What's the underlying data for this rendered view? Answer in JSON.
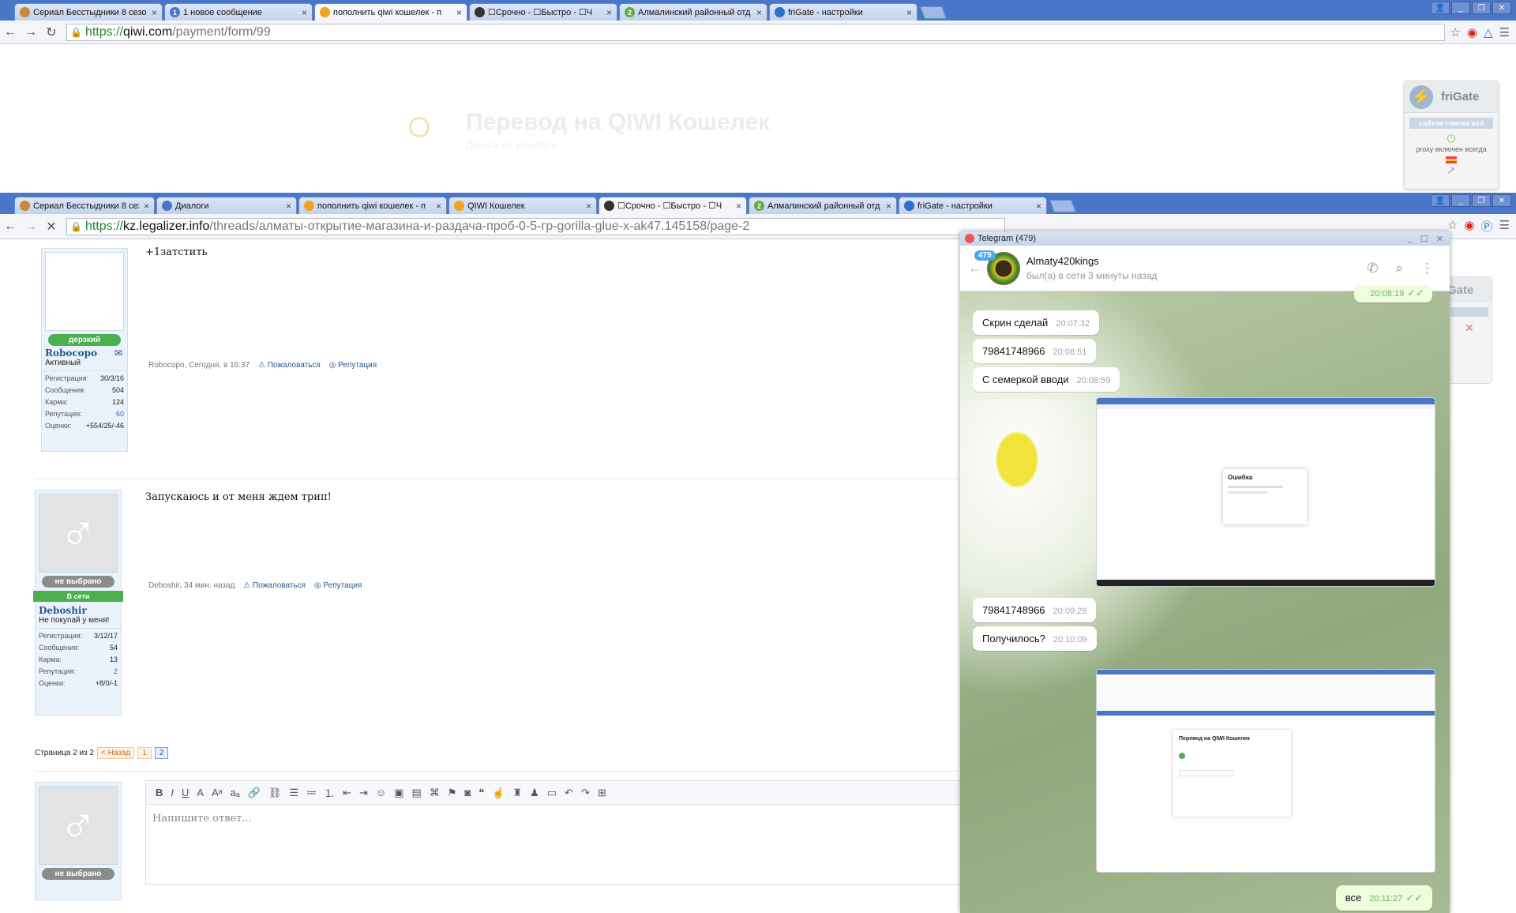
{
  "browser1": {
    "tabs": [
      {
        "title": "Сериал Бесстыдники 8 сезон",
        "fav": "#c98a3a"
      },
      {
        "title": "1 новое сообщение",
        "fav": "#4a76c9",
        "favtext": "1"
      },
      {
        "title": "пополнить qiwi кошелек - п",
        "fav": "#f3a41c",
        "active": true
      },
      {
        "title": "☐Срочно - ☐Быстро - ☐Ч",
        "fav": "#333"
      },
      {
        "title": "Алмалинский районный отд",
        "fav": "#5fae3a",
        "favtext": "2"
      },
      {
        "title": "friGate - настройки",
        "fav": "#2a6fd1"
      }
    ],
    "url_https": "https://",
    "url_host": "qiwi.com",
    "url_path": "/payment/form/99"
  },
  "qiwi": {
    "title": "Перевод на QIWI Кошелек",
    "subtitle": "Деньги на кошелек"
  },
  "frigate": {
    "title": "friGate",
    "badge": "сайтов списка asd",
    "status": "proxy включен всегда"
  },
  "browser2": {
    "tabs": [
      {
        "title": "Сериал Бесстыдники 8 сезон",
        "fav": "#c98a3a"
      },
      {
        "title": "Диалоги",
        "fav": "#4a76c9"
      },
      {
        "title": "пополнить qiwi кошелек - п",
        "fav": "#f3a41c"
      },
      {
        "title": "QIWI Кошелек",
        "fav": "#f3a41c"
      },
      {
        "title": "☐Срочно - ☐Быстро - ☐Ч",
        "fav": "#333",
        "active": true
      },
      {
        "title": "Алмалинский районный отд",
        "fav": "#5fae3a",
        "favtext": "2"
      },
      {
        "title": "friGate - настройки",
        "fav": "#2a6fd1"
      }
    ],
    "url_https": "https://",
    "url_host": "kz.legalizer.info",
    "url_path": "/threads/алматы-открытие-магазина-и-раздача-проб-0-5-гр-gorilla-glue-x-ak47.145158/page-2"
  },
  "posts": [
    {
      "message": "+1затстить",
      "rank": "дерзкий",
      "rank_color": "#4caf50",
      "username": "Robocopo",
      "usertitle": "Активный",
      "meta": "Robocopo, Сегодня, в 16:37",
      "stats": [
        {
          "k": "Регистрация:",
          "v": "30/3/16"
        },
        {
          "k": "Сообщения:",
          "v": "504"
        },
        {
          "k": "Карма:",
          "v": "124"
        },
        {
          "k": "Репутация:",
          "v": "60"
        },
        {
          "k": "Оценки:",
          "v": "+554/25/-46"
        }
      ]
    },
    {
      "message": "Запускаюсь и от меня ждем трип!",
      "rank": "не выбрано",
      "rank_color": "#8c8c8c",
      "online": "В сети",
      "username": "Deboshir",
      "usertitle": "Не покупай у меня!",
      "meta": "Deboshir, 34 мин. назад",
      "stats": [
        {
          "k": "Регистрация:",
          "v": "3/12/17"
        },
        {
          "k": "Сообщения:",
          "v": "54"
        },
        {
          "k": "Карма:",
          "v": "13"
        },
        {
          "k": "Репутация:",
          "v": "2"
        },
        {
          "k": "Оценки:",
          "v": "+8/0/-1"
        }
      ]
    }
  ],
  "actions": {
    "report": "Пожаловаться",
    "reputation": "Репутация"
  },
  "pagination": {
    "label": "Страница 2 из 2",
    "prev": "< Назад",
    "pages": [
      "1",
      "2"
    ]
  },
  "reply": {
    "placeholder": "Напишите ответ...",
    "rank": "не выбрано"
  },
  "telegram": {
    "window_title": "Telegram (479)",
    "unread": "479",
    "contact": "Almaty420kings",
    "status": "был(а) в сети 3 минуты назад",
    "top_time": "20:08:19",
    "messages": [
      {
        "text": "Скрин сделай",
        "time": "20:07:32"
      },
      {
        "text": "79841748966",
        "time": "20:08:51"
      },
      {
        "text": "С семеркой вводи",
        "time": "20:08:59"
      },
      {
        "text": "79841748966",
        "time": "20:09:28"
      },
      {
        "text": "Получилось?",
        "time": "20:10:09"
      }
    ],
    "screenshot1": {
      "title": "Ошибка"
    },
    "screenshot2": {
      "title": "Перевод на QIWI Кошелек"
    },
    "outgoing": {
      "text": "все",
      "time": "20:11:27"
    }
  }
}
